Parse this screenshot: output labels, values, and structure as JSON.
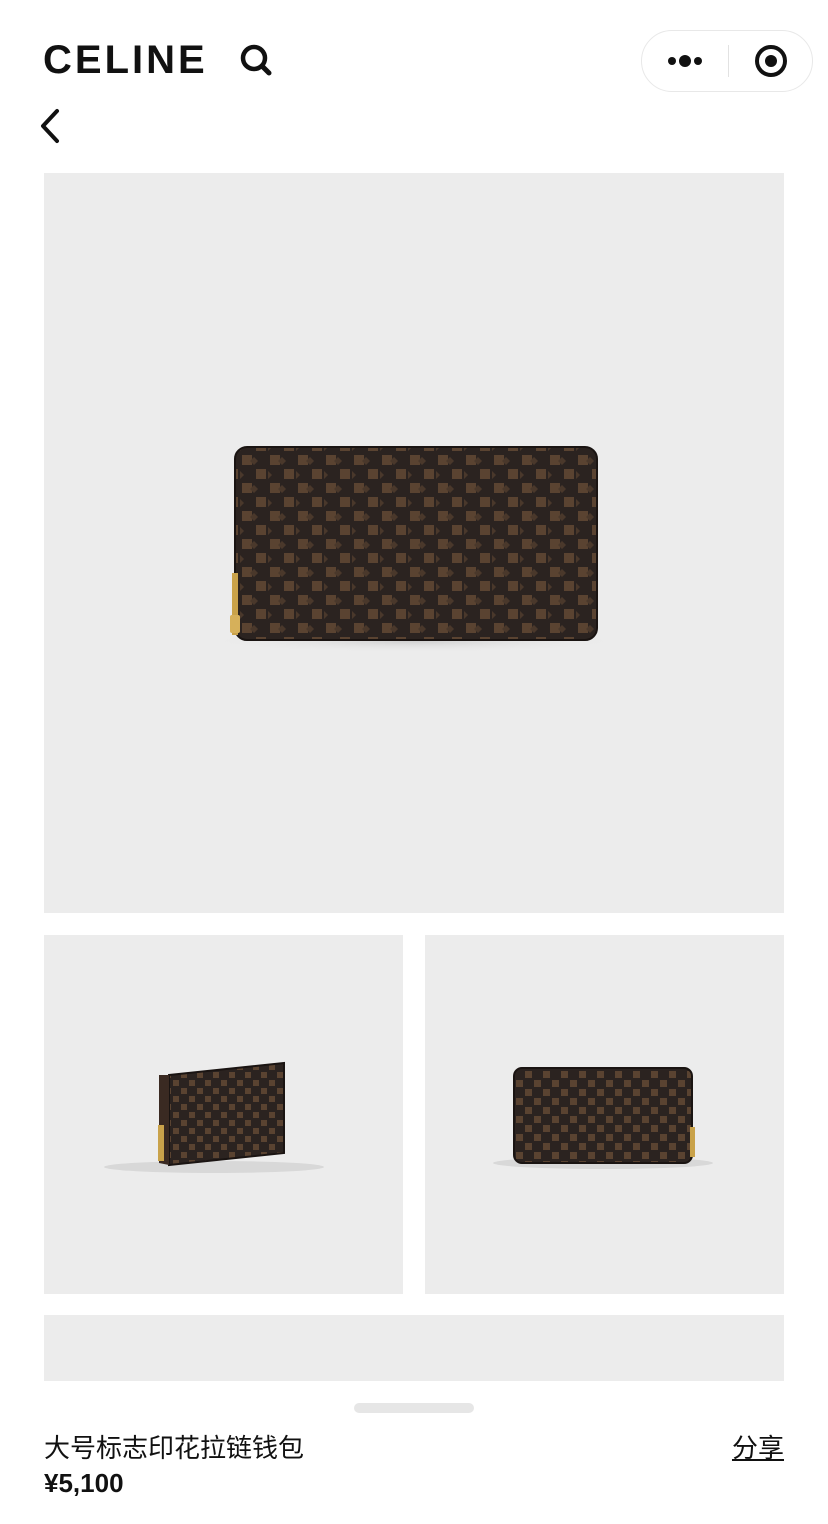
{
  "header": {
    "logo": "CELINE",
    "search_icon": "search-icon",
    "more_icon": "more-dots-icon",
    "close_icon": "target-circle-icon",
    "back_icon": "chevron-left-icon"
  },
  "gallery": {
    "main_alt": "wallet front view",
    "thumbs": [
      "wallet angled view",
      "wallet back view"
    ]
  },
  "product": {
    "name": "大号标志印花拉链钱包",
    "price": "¥5,100",
    "share_label": "分享"
  },
  "colors": {
    "image_bg": "#ececec",
    "wallet_dark": "#2b2320",
    "wallet_pattern": "#5a4331",
    "zipper": "#c9a24a"
  }
}
